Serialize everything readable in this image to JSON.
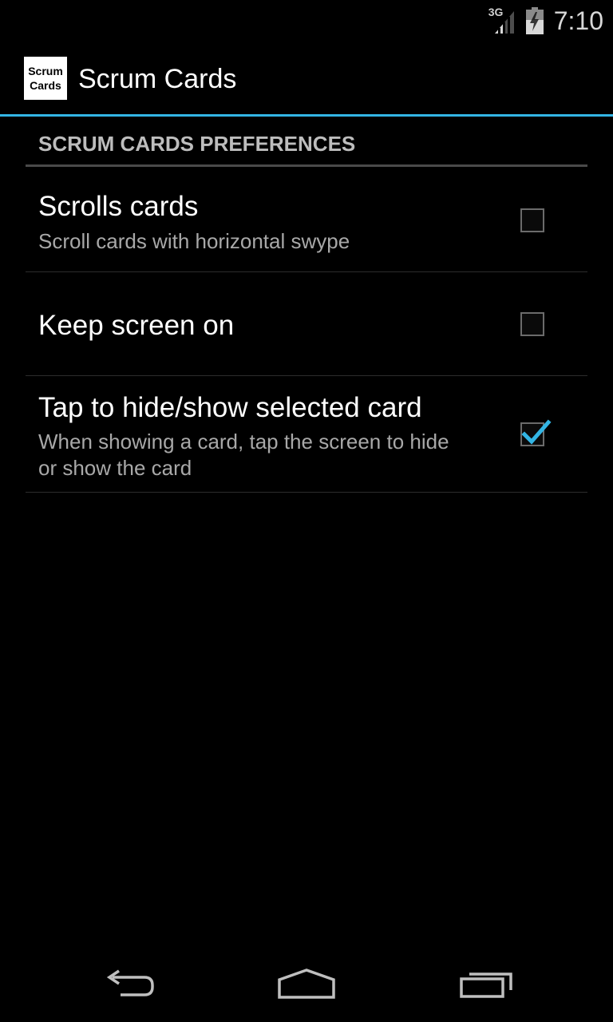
{
  "status_bar": {
    "network_type": "3G",
    "time": "7:10",
    "icons": [
      "signal-icon",
      "battery-icon"
    ]
  },
  "action_bar": {
    "logo_line1": "Scrum",
    "logo_line2": "Cards",
    "title": "Scrum Cards",
    "accent_color": "#33b5e5"
  },
  "preferences": {
    "category_title": "SCRUM CARDS PREFERENCES",
    "items": [
      {
        "title": "Scrolls cards",
        "summary": "Scroll cards with horizontal swype",
        "checked": false
      },
      {
        "title": "Keep screen on",
        "summary": "",
        "checked": false
      },
      {
        "title": "Tap to hide/show selected card",
        "summary": "When showing a card, tap the screen to hide or show the card",
        "checked": true
      }
    ]
  },
  "nav_bar": {
    "icons": [
      "back-icon",
      "home-icon",
      "recents-icon"
    ]
  }
}
